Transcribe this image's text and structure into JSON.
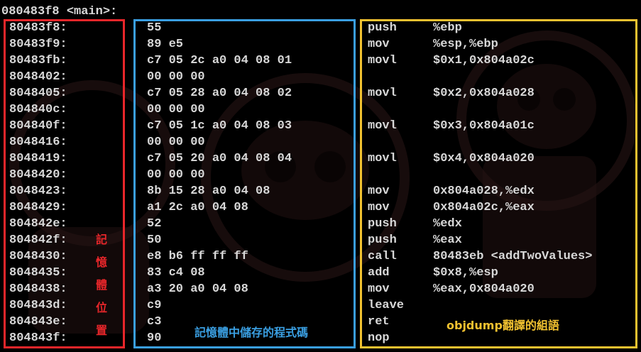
{
  "header": "080483f8 <main>:",
  "rows": [
    {
      "addr": "80483f8:",
      "bytes": "55",
      "mnemonic": "push",
      "operands": "%ebp"
    },
    {
      "addr": "80483f9:",
      "bytes": "89 e5",
      "mnemonic": "mov",
      "operands": "%esp,%ebp"
    },
    {
      "addr": "80483fb:",
      "bytes": "c7 05 2c a0 04 08 01",
      "mnemonic": "movl",
      "operands": "$0x1,0x804a02c"
    },
    {
      "addr": "8048402:",
      "bytes": "00 00 00",
      "mnemonic": "",
      "operands": ""
    },
    {
      "addr": "8048405:",
      "bytes": "c7 05 28 a0 04 08 02",
      "mnemonic": "movl",
      "operands": "$0x2,0x804a028"
    },
    {
      "addr": "804840c:",
      "bytes": "00 00 00",
      "mnemonic": "",
      "operands": ""
    },
    {
      "addr": "804840f:",
      "bytes": "c7 05 1c a0 04 08 03",
      "mnemonic": "movl",
      "operands": "$0x3,0x804a01c"
    },
    {
      "addr": "8048416:",
      "bytes": "00 00 00",
      "mnemonic": "",
      "operands": ""
    },
    {
      "addr": "8048419:",
      "bytes": "c7 05 20 a0 04 08 04",
      "mnemonic": "movl",
      "operands": "$0x4,0x804a020"
    },
    {
      "addr": "8048420:",
      "bytes": "00 00 00",
      "mnemonic": "",
      "operands": ""
    },
    {
      "addr": "8048423:",
      "bytes": "8b 15 28 a0 04 08",
      "mnemonic": "mov",
      "operands": "0x804a028,%edx"
    },
    {
      "addr": "8048429:",
      "bytes": "a1 2c a0 04 08",
      "mnemonic": "mov",
      "operands": "0x804a02c,%eax"
    },
    {
      "addr": "804842e:",
      "bytes": "52",
      "mnemonic": "push",
      "operands": "%edx"
    },
    {
      "addr": "804842f:",
      "bytes": "50",
      "mnemonic": "push",
      "operands": "%eax"
    },
    {
      "addr": "8048430:",
      "bytes": "e8 b6 ff ff ff",
      "mnemonic": "call",
      "operands": "80483eb <addTwoValues>"
    },
    {
      "addr": "8048435:",
      "bytes": "83 c4 08",
      "mnemonic": "add",
      "operands": "$0x8,%esp"
    },
    {
      "addr": "8048438:",
      "bytes": "a3 20 a0 04 08",
      "mnemonic": "mov",
      "operands": "%eax,0x804a020"
    },
    {
      "addr": "804843d:",
      "bytes": "c9",
      "mnemonic": "leave",
      "operands": ""
    },
    {
      "addr": "804843e:",
      "bytes": "c3",
      "mnemonic": "ret",
      "operands": ""
    },
    {
      "addr": "804843f:",
      "bytes": "90",
      "mnemonic": "nop",
      "operands": ""
    }
  ],
  "annotations": {
    "memory_address_label": "記憶體位置",
    "stored_program_label": "記憶體中儲存的程式碼",
    "objdump_label": "objdump翻譯的組語"
  },
  "colors": {
    "background": "#000000",
    "text": "#d8d8d8",
    "address_box": "#e8262a",
    "bytes_box": "#3a9fe2",
    "assembly_box": "#f2c230",
    "watermark": "#2a1616"
  }
}
